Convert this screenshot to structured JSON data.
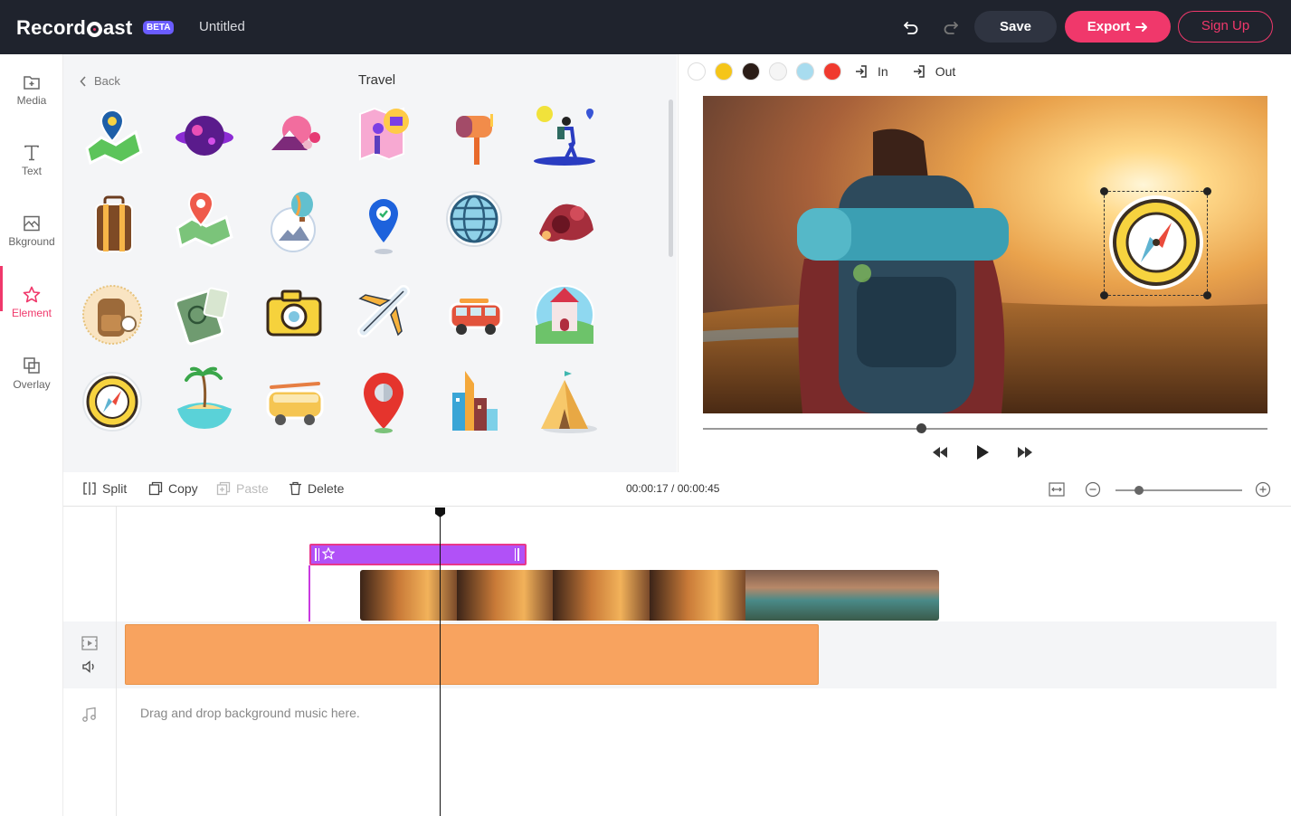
{
  "app": {
    "brand": "RecordCast",
    "brand_pre": "Record",
    "brand_post": "ast",
    "beta": "BETA",
    "doc_title": "Untitled",
    "save_label": "Save",
    "export_label": "Export",
    "signup_label": "Sign Up",
    "accent_color": "#f0386b"
  },
  "sidebar": {
    "items": [
      {
        "label": "Media",
        "icon": "media-icon"
      },
      {
        "label": "Text",
        "icon": "text-icon"
      },
      {
        "label": "Bkground",
        "icon": "background-icon"
      },
      {
        "label": "Element",
        "icon": "star-icon",
        "active": true
      },
      {
        "label": "Overlay",
        "icon": "overlay-icon"
      }
    ]
  },
  "panel": {
    "back_label": "Back",
    "title": "Travel",
    "elements": [
      "map-pin-sticker",
      "purple-planet-sticker",
      "mount-fuji-sticker",
      "city-map-sticker",
      "mailbox-sticker",
      "hiker-sticker",
      "suitcase-sticker",
      "map-location-sticker",
      "hot-air-balloon-sticker",
      "checked-location-sticker",
      "globe-sticker",
      "red-hills-sticker",
      "backpack-sticker",
      "passport-sticker",
      "camera-sticker",
      "airplane-sticker",
      "camper-van-sticker",
      "castle-sticker",
      "compass-sticker",
      "island-sticker",
      "surf-van-sticker",
      "red-pin-sticker",
      "city-towers-sticker",
      "tent-sticker"
    ]
  },
  "preview": {
    "colors": [
      "#ffffff",
      "#f5c518",
      "#2b1d17",
      "#f5f5f5",
      "#a8dcef",
      "#f03a2e"
    ],
    "in_label": "In",
    "out_label": "Out",
    "seek_progress": 0.385
  },
  "toolbar": {
    "split": "Split",
    "copy": "Copy",
    "paste": "Paste",
    "delete": "Delete",
    "timecode": "00:00:17 / 00:00:45",
    "zoom_level": 0.18
  },
  "timeline": {
    "music_hint": "Drag and drop background music here."
  }
}
